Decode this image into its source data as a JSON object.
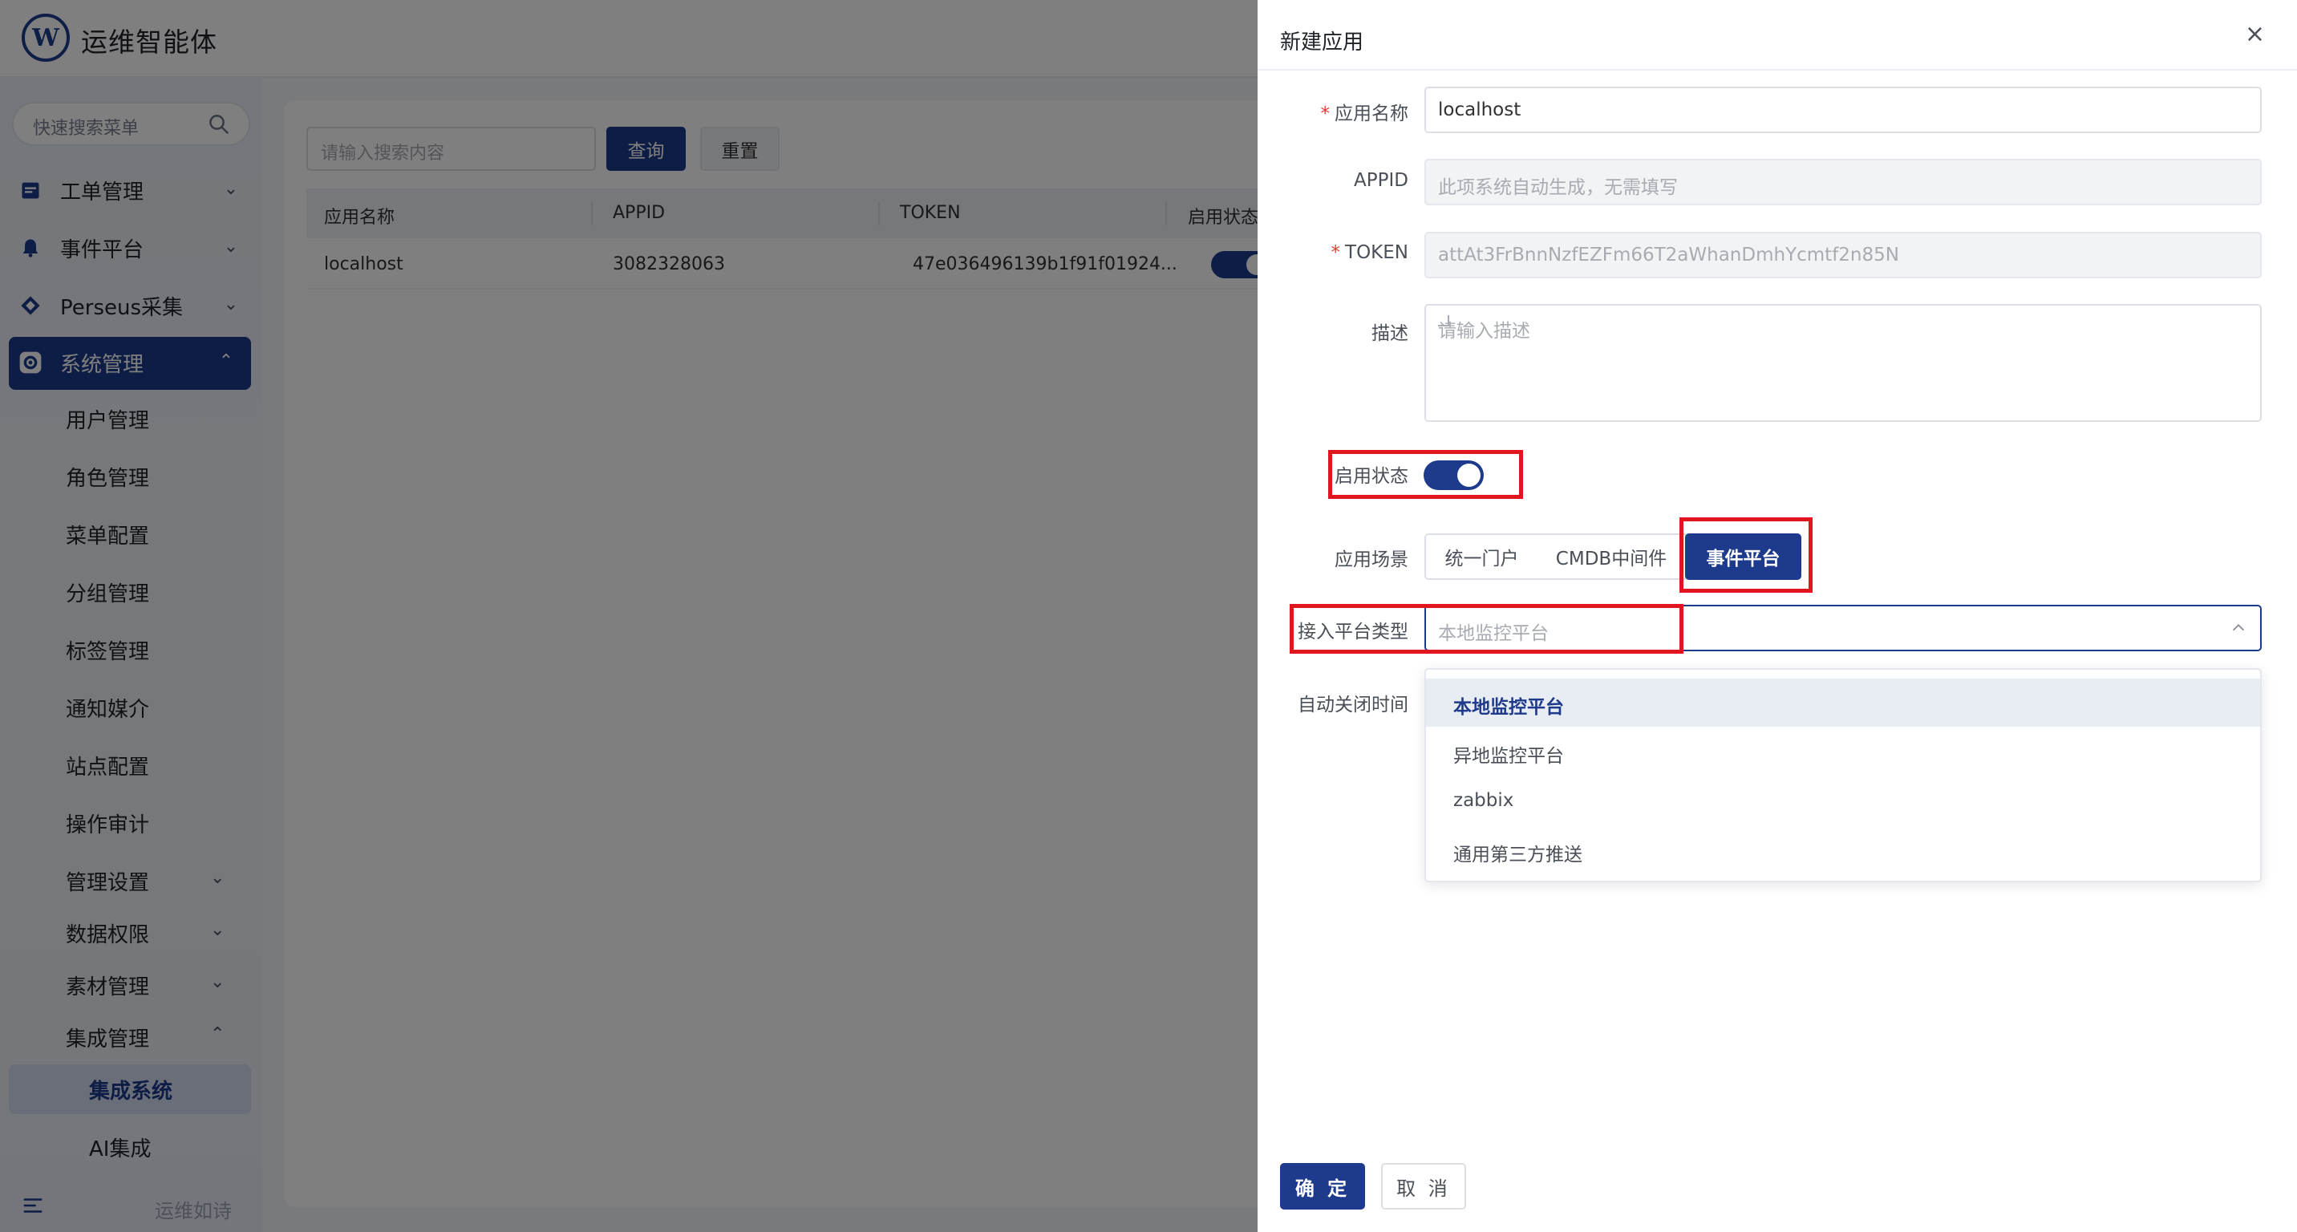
{
  "app": {
    "title": "运维智能体",
    "logo_letter": "W"
  },
  "sidebar": {
    "search_placeholder": "快速搜索菜单",
    "menus": [
      {
        "label": "工单管理",
        "icon": "calendar-icon"
      },
      {
        "label": "事件平台",
        "icon": "bell-icon"
      },
      {
        "label": "Perseus采集",
        "icon": "diamond-icon"
      },
      {
        "label": "系统管理",
        "icon": "gear-icon",
        "active": true
      }
    ],
    "sub_items": [
      "用户管理",
      "角色管理",
      "菜单配置",
      "分组管理",
      "标签管理",
      "通知媒介",
      "站点配置",
      "操作审计",
      "管理设置",
      "数据权限",
      "素材管理",
      "集成管理"
    ],
    "integration_items": [
      "集成系统",
      "AI集成"
    ],
    "footer_text": "运维如诗"
  },
  "list": {
    "search_placeholder": "请输入搜索内容",
    "query_label": "查询",
    "reset_label": "重置",
    "columns": [
      "应用名称",
      "APPID",
      "TOKEN",
      "启用状态"
    ],
    "rows": [
      {
        "name": "localhost",
        "appid": "3082328063",
        "token": "47e036496139b1f91f01924...",
        "enabled": true
      }
    ]
  },
  "drawer": {
    "title": "新建应用",
    "close": "×",
    "fields": {
      "name_label": "应用名称",
      "name_value": "localhost",
      "appid_label": "APPID",
      "appid_placeholder": "此项系统自动生成，无需填写",
      "token_label": "TOKEN",
      "token_value": "attAt3FrBnnNzfEZFm66T2aWhanDmhYcmtf2n85N",
      "desc_label": "描述",
      "desc_placeholder": "请输入描述",
      "status_label": "启用状态",
      "status_on": true,
      "scene_label": "应用场景",
      "scene_options": [
        "统一门户",
        "CMDB中间件",
        "事件平台"
      ],
      "scene_selected": "事件平台",
      "platform_label": "接入平台类型",
      "platform_placeholder": "本地监控平台",
      "close_time_label": "自动关闭时间"
    },
    "dropdown_options": [
      "本地监控平台",
      "异地监控平台",
      "zabbix",
      "通用第三方推送"
    ],
    "dropdown_selected": "本地监控平台",
    "ok_label": "确 定",
    "cancel_label": "取 消"
  },
  "colors": {
    "primary": "#1d3a8c",
    "highlight_box": "#e0151e",
    "required": "#e53935"
  }
}
